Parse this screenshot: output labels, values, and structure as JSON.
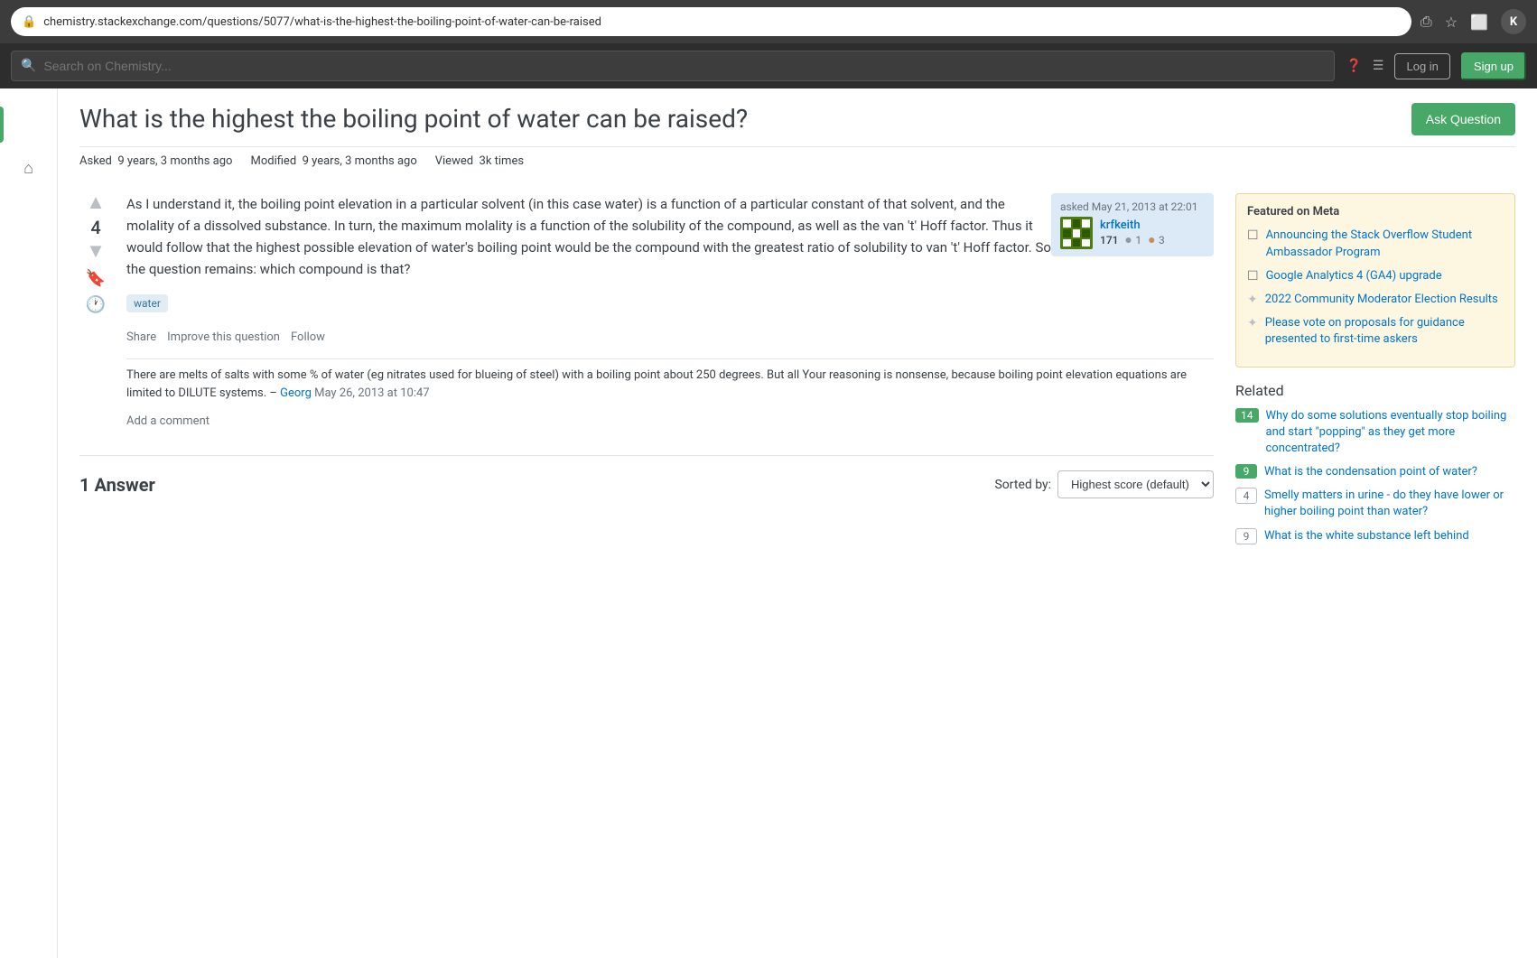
{
  "browser": {
    "url": "chemistry.stackexchange.com/questions/5077/what-is-the-highest-the-boiling-point-of-water-can-be-raised",
    "avatar_initial": "K"
  },
  "nav": {
    "search_placeholder": "Search on Chemistry...",
    "login_label": "Log in",
    "signup_label": "Sign up"
  },
  "question": {
    "title": "What is the highest the boiling point of water can be raised?",
    "asked_label": "Asked",
    "asked_value": "9 years, 3 months ago",
    "modified_label": "Modified",
    "modified_value": "9 years, 3 months ago",
    "viewed_label": "Viewed",
    "viewed_value": "3k times",
    "ask_button": "Ask Question",
    "vote_count": "4",
    "body": "As I understand it, the boiling point elevation in a particular solvent (in this case water) is a function of a particular constant of that solvent, and the molality of a dissolved substance. In turn, the maximum molality is a function of the solubility of the compound, as well as the van 't' Hoff factor. Thus it would follow that the highest possible elevation of water's boiling point would be the compound with the greatest ratio of solubility to van 't' Hoff factor. So the question remains: which compound is that?",
    "tag": "water",
    "action_share": "Share",
    "action_improve": "Improve this question",
    "action_follow": "Follow",
    "asked_meta": "asked May 21, 2013 at 22:01",
    "user_name": "krfkeith",
    "user_rep": "171",
    "user_badge_silver": "1",
    "user_badge_bronze": "3",
    "comment_text": "There are melts of salts with some % of water (eg nitrates used for blueing of steel) with a boiling point about 250 degrees. But all Your reasoning is nonsense, because boiling point elevation equations are limited to DILUTE systems.",
    "comment_author": "Georg",
    "comment_date": "May 26, 2013 at 10:47",
    "add_comment": "Add a comment",
    "answers_label": "1 Answer",
    "sort_label": "Sorted by:",
    "sort_option": "Highest score (default)"
  },
  "featured": {
    "title": "Featured on Meta",
    "items": [
      {
        "id": "meta-item-1",
        "icon": "☐",
        "text": "Announcing the Stack Overflow Student Ambassador Program"
      },
      {
        "id": "meta-item-2",
        "icon": "☐",
        "text": "Google Analytics 4 (GA4) upgrade"
      },
      {
        "id": "meta-item-3",
        "icon": "✦",
        "text": "2022 Community Moderator Election Results"
      },
      {
        "id": "meta-item-4",
        "icon": "✦",
        "text": "Please vote on proposals for guidance presented to first-time askers"
      }
    ]
  },
  "related": {
    "title": "Related",
    "items": [
      {
        "score": "14",
        "score_type": "positive",
        "text": "Why do some solutions eventually stop boiling and start \"popping\" as they get more concentrated?"
      },
      {
        "score": "9",
        "score_type": "positive",
        "text": "What is the condensation point of water?"
      },
      {
        "score": "4",
        "score_type": "neutral",
        "text": "Smelly matters in urine - do they have lower or higher boiling point than water?"
      },
      {
        "score": "9",
        "score_type": "neutral",
        "text": "What is the white substance left behind"
      }
    ]
  }
}
